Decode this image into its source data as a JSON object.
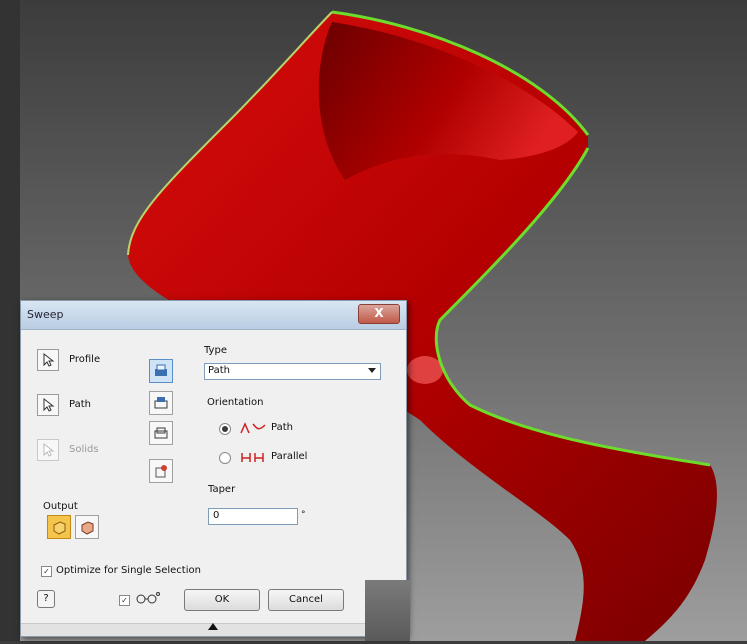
{
  "dialog": {
    "title": "Sweep",
    "close_label": "X",
    "selectors": [
      {
        "label": "Profile",
        "enabled": true
      },
      {
        "label": "Path",
        "enabled": true
      },
      {
        "label": "Solids",
        "enabled": false
      }
    ],
    "type_label": "Type",
    "type_value": "Path",
    "orientation_label": "Orientation",
    "orientation_options": [
      {
        "label": "Path",
        "checked": true
      },
      {
        "label": "Parallel",
        "checked": false
      }
    ],
    "taper_label": "Taper",
    "taper_value": "0",
    "taper_unit": "°",
    "output_label": "Output",
    "optimize_label": "Optimize for Single Selection",
    "help_label": "?",
    "ok_label": "OK",
    "cancel_label": "Cancel"
  },
  "colors": {
    "part_red": "#c00000",
    "edge_green": "#6ddc2c",
    "viewport_dark": "#3c3c3c"
  }
}
